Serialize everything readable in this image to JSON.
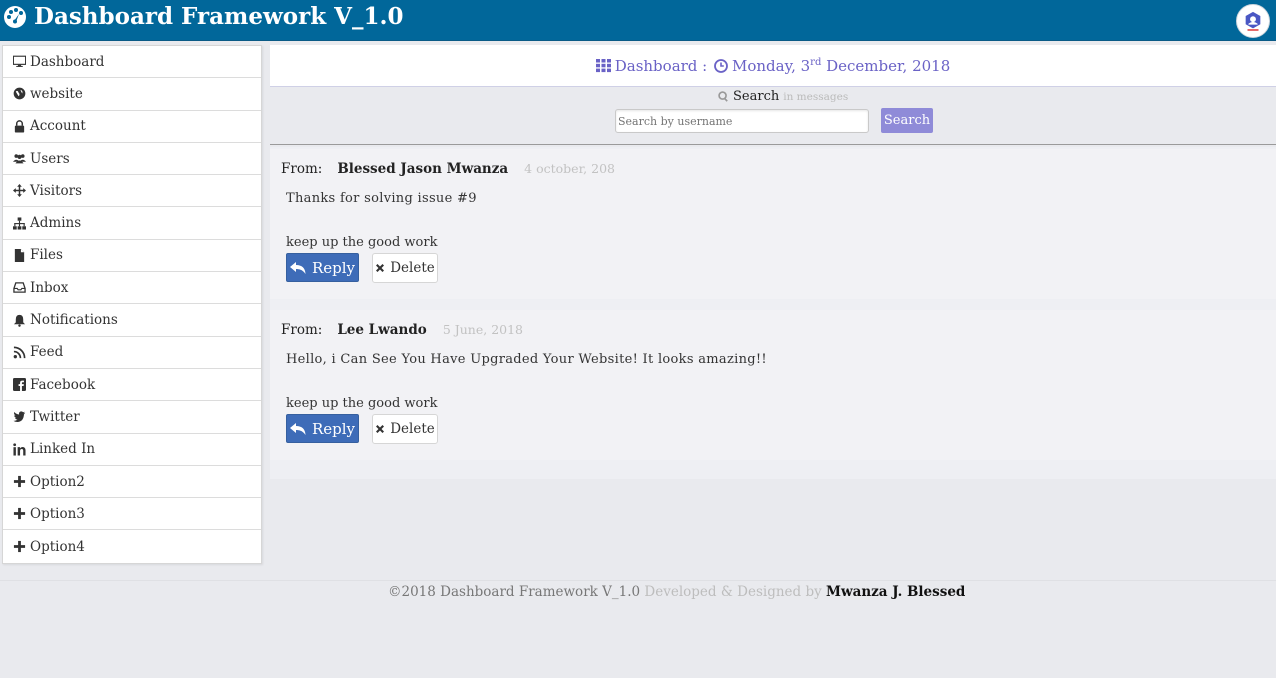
{
  "header": {
    "title": "Dashboard Framework V_1.0",
    "logo_icon": "gauge-icon",
    "avatar_icon": "user-avatar-icon"
  },
  "sidebar": {
    "items": [
      {
        "label": "Dashboard",
        "icon": "monitor-icon"
      },
      {
        "label": "website",
        "icon": "globe-icon"
      },
      {
        "label": "Account",
        "icon": "lock-icon"
      },
      {
        "label": "Users",
        "icon": "users-icon"
      },
      {
        "label": "Visitors",
        "icon": "arrows-icon"
      },
      {
        "label": "Admins",
        "icon": "sitemap-icon"
      },
      {
        "label": "Files",
        "icon": "file-icon"
      },
      {
        "label": "Inbox",
        "icon": "inbox-icon"
      },
      {
        "label": "Notifications",
        "icon": "bell-icon"
      },
      {
        "label": "Feed",
        "icon": "rss-icon"
      },
      {
        "label": "Facebook",
        "icon": "facebook-icon"
      },
      {
        "label": "Twitter",
        "icon": "twitter-icon"
      },
      {
        "label": "Linked In",
        "icon": "linkedin-icon"
      },
      {
        "label": "Option2",
        "icon": "plus-icon"
      },
      {
        "label": "Option3",
        "icon": "plus-icon"
      },
      {
        "label": "Option4",
        "icon": "plus-icon"
      }
    ]
  },
  "main": {
    "heading_prefix": "Dashboard : ",
    "date_day": "Monday, 3",
    "date_suffix": "rd",
    "date_rest": " December, 2018",
    "accent": "#6a62c6"
  },
  "search": {
    "label": "Search",
    "hint": "in messages",
    "placeholder": "Search by username",
    "button": "Search"
  },
  "messages": [
    {
      "from_label": "From:",
      "name": "Blessed Jason Mwanza",
      "date": "4 october, 208",
      "text": "Thanks for solving issue #9",
      "signoff": "keep up the good work",
      "reply": "Reply",
      "delete": "Delete"
    },
    {
      "from_label": "From:",
      "name": "Lee Lwando",
      "date": "5 June, 2018",
      "text": "Hello, i Can See You Have Upgraded Your Website! It looks amazing!!",
      "signoff": "keep up the good work",
      "reply": "Reply",
      "delete": "Delete"
    }
  ],
  "footer": {
    "copyright": "©2018 Dashboard Framework V_1.0",
    "credit": " Developed & Designed by ",
    "author": "Mwanza J. Blessed"
  }
}
